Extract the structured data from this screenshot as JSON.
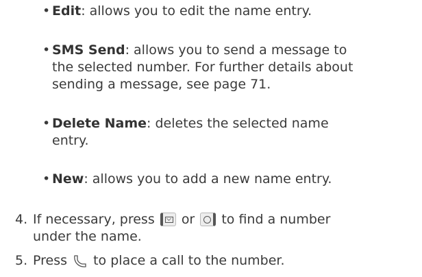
{
  "bullets": [
    {
      "term": "Edit",
      "desc_lines": [
        ": allows you to edit the name entry."
      ]
    },
    {
      "term": "SMS Send",
      "desc_lines": [
        ": allows you to send a message to",
        "the selected number. For further details about",
        "sending a message, see page 71."
      ]
    },
    {
      "term": "Delete Name",
      "desc_lines": [
        ": deletes the selected name",
        "entry."
      ]
    },
    {
      "term": "New",
      "desc_lines": [
        ": allows you to add a new name entry."
      ]
    }
  ],
  "step4": {
    "number": "4.",
    "text_a": "If necessary, press",
    "text_b": "or",
    "text_c": "to find a number",
    "line2": "under the name."
  },
  "step5": {
    "number": "5.",
    "text_a": "Press",
    "text_b": "to place a call to the number."
  },
  "icons": {
    "key_left": "message-key-icon",
    "key_right": "contacts-key-icon",
    "call": "call-key-icon"
  }
}
